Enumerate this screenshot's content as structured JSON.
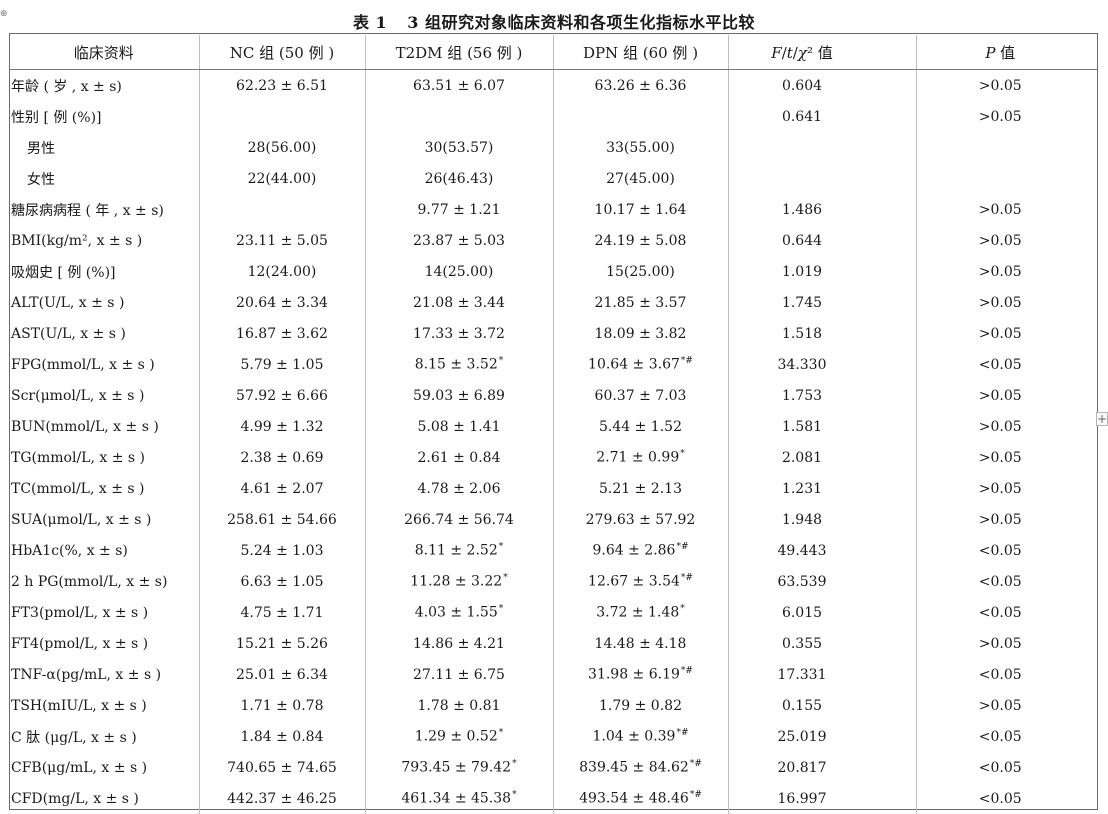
{
  "table": {
    "title_number": "表 1",
    "title_text": "3 组研究对象临床资料和各项生化指标水平比较",
    "headers": [
      "临床资料",
      "NC 组 (50 例 )",
      "T2DM 组 (56 例 )",
      "DPN 组 (60 例 )",
      "F/t/χ² 值",
      "P 值"
    ],
    "rows": [
      {
        "label": "年龄 ( 岁 , x ± s)",
        "nc": "62.23 ± 6.51",
        "t2dm": "63.51 ± 6.07",
        "dpn": "63.26 ± 6.36",
        "stat": "0.604",
        "p": ">0.05"
      },
      {
        "label": "性别 [ 例 (%)]",
        "nc": "",
        "t2dm": "",
        "dpn": "",
        "stat": "0.641",
        "p": ">0.05"
      },
      {
        "label": "男性",
        "nc": "28(56.00)",
        "t2dm": "30(53.57)",
        "dpn": "33(55.00)",
        "stat": "",
        "p": "",
        "indent": true
      },
      {
        "label": "女性",
        "nc": "22(44.00)",
        "t2dm": "26(46.43)",
        "dpn": "27(45.00)",
        "stat": "",
        "p": "",
        "indent": true
      },
      {
        "label": "糖尿病病程 ( 年 , x ± s)",
        "nc": "",
        "t2dm": "9.77 ± 1.21",
        "dpn": "10.17 ± 1.64",
        "stat": "1.486",
        "p": ">0.05"
      },
      {
        "label": "BMI(kg/m², x ± s )",
        "nc": "23.11 ± 5.05",
        "t2dm": "23.87 ± 5.03",
        "dpn": "24.19 ± 5.08",
        "stat": "0.644",
        "p": ">0.05"
      },
      {
        "label": "吸烟史 [ 例 (%)]",
        "nc": "12(24.00)",
        "t2dm": "14(25.00)",
        "dpn": "15(25.00)",
        "stat": "1.019",
        "p": ">0.05"
      },
      {
        "label": "ALT(U/L, x ± s )",
        "nc": "20.64 ± 3.34",
        "t2dm": "21.08 ± 3.44",
        "dpn": "21.85 ± 3.57",
        "stat": "1.745",
        "p": ">0.05"
      },
      {
        "label": "AST(U/L, x ± s )",
        "nc": "16.87 ± 3.62",
        "t2dm": "17.33 ± 3.72",
        "dpn": "18.09 ± 3.82",
        "stat": "1.518",
        "p": ">0.05"
      },
      {
        "label": "FPG(mmol/L, x ± s )",
        "nc": "5.79 ± 1.05",
        "t2dm": "8.15 ± 3.52",
        "t2dm_mark": "*",
        "dpn": "10.64 ± 3.67",
        "dpn_mark": "*#",
        "stat": "34.330",
        "p": "<0.05"
      },
      {
        "label": "Scr(μmol/L, x ± s )",
        "nc": "57.92 ± 6.66",
        "t2dm": "59.03 ± 6.89",
        "dpn": "60.37 ± 7.03",
        "stat": "1.753",
        "p": ">0.05"
      },
      {
        "label": "BUN(mmol/L, x ± s )",
        "nc": "4.99 ± 1.32",
        "t2dm": "5.08 ± 1.41",
        "dpn": "5.44 ± 1.52",
        "stat": "1.581",
        "p": ">0.05"
      },
      {
        "label": "TG(mmol/L, x ± s )",
        "nc": "2.38 ± 0.69",
        "t2dm": "2.61 ± 0.84",
        "dpn": "2.71 ± 0.99",
        "dpn_mark": "*",
        "stat": "2.081",
        "p": ">0.05"
      },
      {
        "label": "TC(mmol/L, x ± s )",
        "nc": "4.61 ± 2.07",
        "t2dm": "4.78 ± 2.06",
        "dpn": "5.21 ± 2.13",
        "stat": "1.231",
        "p": ">0.05"
      },
      {
        "label": "SUA(μmol/L, x ± s )",
        "nc": "258.61 ± 54.66",
        "t2dm": "266.74 ± 56.74",
        "dpn": "279.63 ± 57.92",
        "stat": "1.948",
        "p": ">0.05"
      },
      {
        "label": "HbA1c(%, x ± s)",
        "nc": "5.24 ± 1.03",
        "t2dm": "8.11 ± 2.52",
        "t2dm_mark": "*",
        "dpn": "9.64 ± 2.86",
        "dpn_mark": "*#",
        "stat": "49.443",
        "p": "<0.05"
      },
      {
        "label": "2 h PG(mmol/L, x ± s)",
        "nc": "6.63 ± 1.05",
        "t2dm": "11.28 ± 3.22",
        "t2dm_mark": "*",
        "dpn": "12.67 ± 3.54",
        "dpn_mark": "*#",
        "stat": "63.539",
        "p": "<0.05"
      },
      {
        "label": "FT3(pmol/L, x ± s )",
        "nc": "4.75 ± 1.71",
        "t2dm": "4.03 ± 1.55",
        "t2dm_mark": "*",
        "dpn": "3.72 ± 1.48",
        "dpn_mark": "*",
        "stat": "6.015",
        "p": "<0.05"
      },
      {
        "label": "FT4(pmol/L, x ± s )",
        "nc": "15.21 ± 5.26",
        "t2dm": "14.86 ± 4.21",
        "dpn": "14.48 ± 4.18",
        "stat": "0.355",
        "p": ">0.05"
      },
      {
        "label": "TNF-α(pg/mL, x ± s )",
        "nc": "25.01 ± 6.34",
        "t2dm": "27.11 ± 6.75",
        "dpn": "31.98 ± 6.19",
        "dpn_mark": "*#",
        "stat": "17.331",
        "p": "<0.05"
      },
      {
        "label": "TSH(mIU/L, x ± s )",
        "nc": "1.71 ± 0.78",
        "t2dm": "1.78 ± 0.81",
        "dpn": "1.79 ± 0.82",
        "stat": "0.155",
        "p": ">0.05"
      },
      {
        "label": "C 肽 (μg/L, x ± s )",
        "nc": "1.84 ± 0.84",
        "t2dm": "1.29 ± 0.52",
        "t2dm_mark": "*",
        "dpn": "1.04 ± 0.39",
        "dpn_mark": "*#",
        "stat": "25.019",
        "p": "<0.05"
      },
      {
        "label": "CFB(μg/mL, x ± s )",
        "nc": "740.65 ± 74.65",
        "t2dm": "793.45 ± 79.42",
        "t2dm_mark": "*",
        "dpn": "839.45 ± 84.62",
        "dpn_mark": "*#",
        "stat": "20.817",
        "p": "<0.05"
      },
      {
        "label": "CFD(mg/L, x ± s )",
        "nc": "442.37 ± 46.25",
        "t2dm": "461.34 ± 45.38",
        "t2dm_mark": "*",
        "dpn": "493.54 ± 48.46",
        "dpn_mark": "*#",
        "stat": "16.997",
        "p": "<0.05"
      }
    ]
  },
  "icons": {
    "table_handle": "move-handle-icon",
    "add_button": "plus-icon"
  },
  "ui": {
    "plus_glyph": "+",
    "handle_glyph": "⊕"
  }
}
